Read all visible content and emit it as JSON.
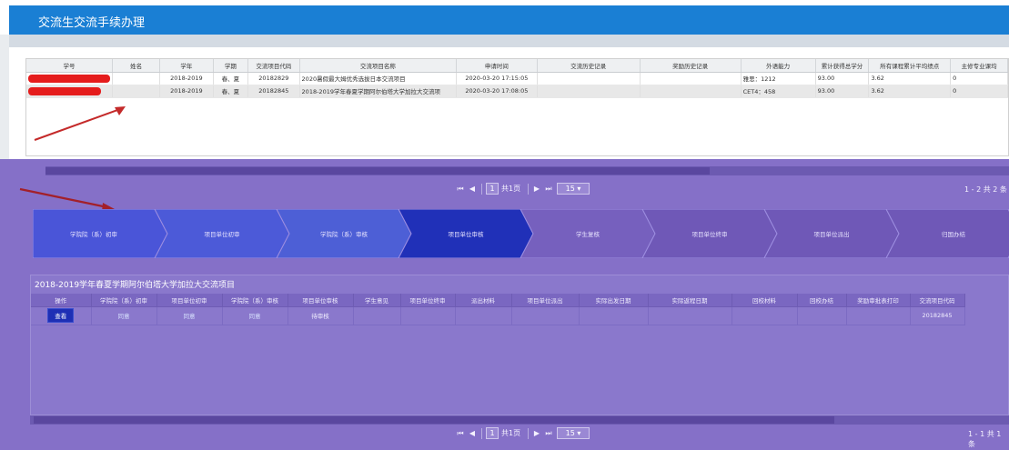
{
  "window": {
    "title": "交流生交流手续办理"
  },
  "colors": {
    "header": "#1a7fd4",
    "overlay": "#8570c8",
    "redaction": "#e51c1c",
    "active_step": "#2030b8"
  },
  "applications": {
    "columns": [
      "学号",
      "姓名",
      "学年",
      "学期",
      "交流项目代码",
      "交流项目名称",
      "申请时间",
      "交流历史记录",
      "奖励历史记录",
      "外语能力",
      "累计获得总学分",
      "所有课程累计平均绩点",
      "主修专业课均"
    ],
    "rows": [
      {
        "student_id": "",
        "name": "",
        "year": "2018-2019",
        "term": "春、夏",
        "code": "20182829",
        "project": "2020暑假最大姆优秀选拔日本交流项目",
        "applied": "2020-03-20 17:15:05",
        "exchange_history": "",
        "award_history": "",
        "language": "雅思：1212",
        "credits": "93.00",
        "gpa": "3.62",
        "major_avg": "0"
      },
      {
        "student_id": "",
        "name": "",
        "year": "2018-2019",
        "term": "春、夏",
        "code": "20182845",
        "project": "2018-2019学年春夏学期阿尔伯塔大学加拉大交流项",
        "applied": "2020-03-20 17:08:05",
        "exchange_history": "",
        "award_history": "",
        "language": "CET4：458",
        "credits": "93.00",
        "gpa": "3.62",
        "major_avg": "0"
      }
    ]
  },
  "pager_top": {
    "first": "⏮",
    "prev": "◀",
    "page": "1",
    "of_pages": "共1页",
    "next": "▶",
    "last": "⏭",
    "size": "15",
    "count": "1 - 2  共 2 条"
  },
  "workflow": {
    "steps": [
      {
        "label": "学院院（系）初审",
        "state": "done"
      },
      {
        "label": "项目单位初审",
        "state": "done"
      },
      {
        "label": "学院院（系）审核",
        "state": "done"
      },
      {
        "label": "项目单位审核",
        "state": "current"
      },
      {
        "label": "学生复核",
        "state": "pending"
      },
      {
        "label": "项目单位终审",
        "state": "pending"
      },
      {
        "label": "项目单位派出",
        "state": "pending"
      },
      {
        "label": "归国办结",
        "state": "pending"
      }
    ]
  },
  "detail": {
    "project_title": "2018-2019学年春夏学期阿尔伯塔大学加拉大交流项目",
    "columns": [
      "操作",
      "学院院（系）初审",
      "项目单位初审",
      "学院院（系）审核",
      "项目单位审核",
      "学生意见",
      "项目单位终审",
      "派出材料",
      "项目单位派出",
      "实际出发日期",
      "实际返程日期",
      "回校材料",
      "回校办结",
      "奖励审批表打印",
      "交流项目代码"
    ],
    "row": {
      "action": "查看",
      "s1": "同意",
      "s2": "同意",
      "s3": "同意",
      "s4": "待审核",
      "code": "20182845"
    }
  },
  "pager_bottom": {
    "first": "⏮",
    "prev": "◀",
    "page": "1",
    "of_pages": "共1页",
    "next": "▶",
    "last": "⏭",
    "size": "15",
    "count": "1 - 1  共 1 条"
  }
}
